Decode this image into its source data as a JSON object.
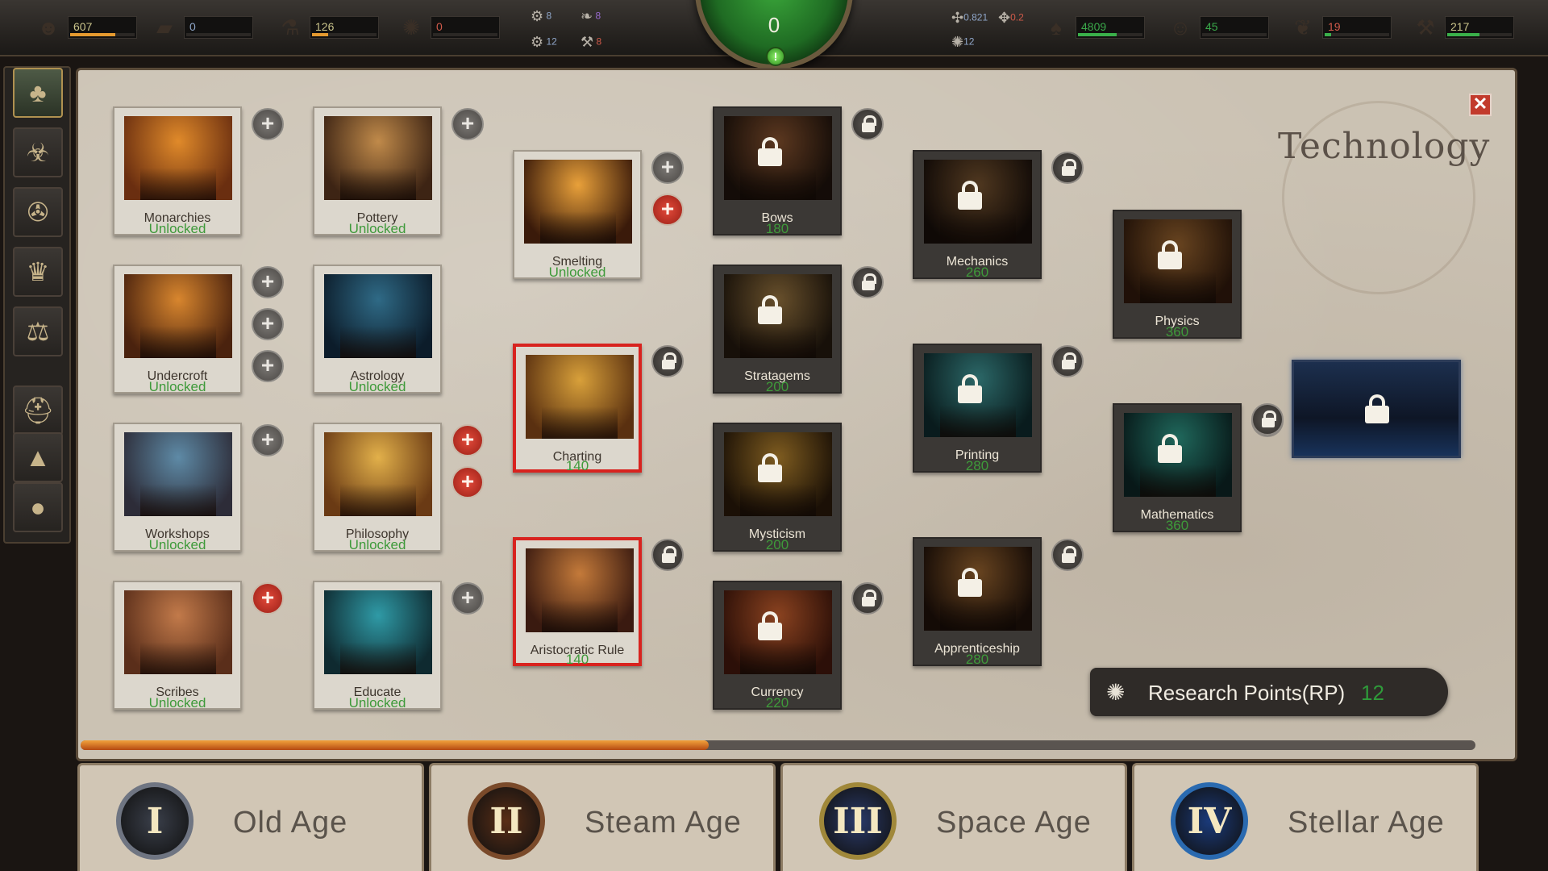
{
  "resources": {
    "left": [
      {
        "icon": "population-icon",
        "glyph": "☻",
        "value": "607",
        "value_color": "#c9c38a",
        "fill": 0.7,
        "fill_color": "#e59a2f"
      },
      {
        "icon": "sleep-bed-icon",
        "glyph": "▰",
        "value": "0",
        "value_color": "#8fa6c9",
        "fill": 0.0,
        "fill_color": "#e59a2f"
      },
      {
        "icon": "potion-icon",
        "glyph": "⚗",
        "value": "126",
        "value_color": "#c9c38a",
        "fill": 0.25,
        "fill_color": "#e59a2f"
      },
      {
        "icon": "virus-icon",
        "glyph": "✺",
        "value": "0",
        "value_color": "#d05a4a",
        "fill": 0.0,
        "fill_color": "#e59a2f"
      }
    ],
    "right": [
      {
        "icon": "mushroom-icon",
        "glyph": "♠",
        "value": "4809",
        "value_color": "#3aa84a",
        "fill": 0.6,
        "fill_color": "#3ab04a"
      },
      {
        "icon": "scholar-icon",
        "glyph": "☺",
        "value": "45",
        "value_color": "#3aa84a",
        "fill": 0.0,
        "fill_color": "#3ab04a"
      },
      {
        "icon": "grain-icon",
        "glyph": "❦",
        "value": "19",
        "value_color": "#d05a4a",
        "fill": 0.1,
        "fill_color": "#3ab04a"
      },
      {
        "icon": "tool-icon",
        "glyph": "⚒",
        "value": "217",
        "value_color": "#c9c38a",
        "fill": 0.5,
        "fill_color": "#3ab04a"
      }
    ],
    "mini_left": [
      {
        "icon": "gear-globe-icon",
        "glyph": "⚙",
        "value": "8",
        "color": "#8fa6c9"
      },
      {
        "icon": "leaf-icon",
        "glyph": "❧",
        "value": "8",
        "color": "#9a6bd0"
      },
      {
        "icon": "cog-icon",
        "glyph": "⚙",
        "value": "12",
        "color": "#8fa6c9"
      },
      {
        "icon": "hammer-icon",
        "glyph": "⚒",
        "value": "8",
        "color": "#d05a4a"
      }
    ],
    "mini_right": [
      {
        "icon": "dna-icon",
        "glyph": "✣",
        "value": "0.821",
        "color": "#8fa6c9"
      },
      {
        "icon": "rate-icon",
        "glyph": "✥",
        "value": "0.2",
        "color": "#d05a4a"
      },
      {
        "icon": "research-icon",
        "glyph": "✺",
        "value": "12",
        "color": "#8fa6c9"
      }
    ],
    "dial_value": "0",
    "dial_button": "!"
  },
  "sidebar": [
    {
      "name": "tech-tree-icon",
      "glyph": "♣",
      "active": true
    },
    {
      "name": "dna-icon",
      "glyph": "☣",
      "active": false
    },
    {
      "name": "map-compass-icon",
      "glyph": "✇",
      "active": false
    },
    {
      "name": "commander-icon",
      "glyph": "♛",
      "active": false
    },
    {
      "name": "scales-icon",
      "glyph": "⚖",
      "active": false
    },
    {
      "name": "helmet-icon",
      "glyph": "⛑",
      "active": false
    },
    {
      "name": "landscape-icon",
      "glyph": "▲",
      "active": false
    },
    {
      "name": "night-icon",
      "glyph": "●",
      "active": false
    }
  ],
  "panel": {
    "title": "Technology",
    "close_glyph": "✕"
  },
  "techs": [
    {
      "id": "monarchies",
      "name": "Monarchies",
      "status": "Unlocked",
      "locked": false,
      "selected": false,
      "art": [
        "#e08a2a",
        "#6a2e10"
      ],
      "buttons": [
        "plus"
      ]
    },
    {
      "id": "pottery",
      "name": "Pottery",
      "status": "Unlocked",
      "locked": false,
      "selected": false,
      "art": [
        "#c08a4a",
        "#3d2414"
      ],
      "buttons": [
        "plus"
      ]
    },
    {
      "id": "undercroft",
      "name": "Undercroft",
      "status": "Unlocked",
      "locked": false,
      "selected": false,
      "art": [
        "#d8862e",
        "#4a220e"
      ],
      "buttons": [
        "plus",
        "plus",
        "plus"
      ]
    },
    {
      "id": "astrology",
      "name": "Astrology",
      "status": "Unlocked",
      "locked": false,
      "selected": false,
      "art": [
        "#2f6a86",
        "#0c1c2a"
      ],
      "buttons": []
    },
    {
      "id": "workshops",
      "name": "Workshops",
      "status": "Unlocked",
      "locked": false,
      "selected": false,
      "art": [
        "#5e8aa6",
        "#2d2c38"
      ],
      "buttons": [
        "plus"
      ]
    },
    {
      "id": "philosophy",
      "name": "Philosophy",
      "status": "Unlocked",
      "locked": false,
      "selected": false,
      "art": [
        "#e2b04a",
        "#6a3a14"
      ],
      "buttons": [
        "red",
        "red"
      ]
    },
    {
      "id": "scribes",
      "name": "Scribes",
      "status": "Unlocked",
      "locked": false,
      "selected": false,
      "art": [
        "#c27a4a",
        "#5a2e1a"
      ],
      "buttons": [
        "red"
      ]
    },
    {
      "id": "educate",
      "name": "Educate",
      "status": "Unlocked",
      "locked": false,
      "selected": false,
      "art": [
        "#2f9aa6",
        "#0f2a30"
      ],
      "buttons": [
        "plus"
      ]
    },
    {
      "id": "smelting",
      "name": "Smelting",
      "status": "Unlocked",
      "locked": false,
      "selected": false,
      "art": [
        "#e8a03a",
        "#3a1a0a"
      ],
      "buttons": [
        "plus",
        "red"
      ]
    },
    {
      "id": "charting",
      "name": "Charting",
      "status": "140",
      "locked": false,
      "selected": true,
      "art": [
        "#d8a03a",
        "#5a3010"
      ],
      "buttons": [
        "lock"
      ]
    },
    {
      "id": "aristocratic-rule",
      "name": "Aristocratic Rule",
      "status": "140",
      "locked": false,
      "selected": true,
      "art": [
        "#c47a3a",
        "#3a1a10"
      ],
      "buttons": [
        "lock"
      ]
    },
    {
      "id": "bows",
      "name": "Bows",
      "status": "180",
      "locked": true,
      "selected": false,
      "art": [
        "#7a4a2a",
        "#1a100a"
      ],
      "buttons": [
        "lock"
      ]
    },
    {
      "id": "stratagems",
      "name": "Stratagems",
      "status": "200",
      "locked": true,
      "selected": false,
      "art": [
        "#8a6a3a",
        "#1e150c"
      ],
      "buttons": [
        "lock"
      ]
    },
    {
      "id": "mysticism",
      "name": "Mysticism",
      "status": "200",
      "locked": true,
      "selected": false,
      "art": [
        "#a87a2a",
        "#241608"
      ],
      "buttons": []
    },
    {
      "id": "currency",
      "name": "Currency",
      "status": "220",
      "locked": true,
      "selected": false,
      "art": [
        "#b8582a",
        "#3a140a"
      ],
      "buttons": [
        "lock"
      ]
    },
    {
      "id": "mechanics",
      "name": "Mechanics",
      "status": "260",
      "locked": true,
      "selected": false,
      "art": [
        "#6a4a2a",
        "#140c08"
      ],
      "buttons": [
        "lock"
      ]
    },
    {
      "id": "printing",
      "name": "Printing",
      "status": "280",
      "locked": true,
      "selected": false,
      "art": [
        "#3a8a8a",
        "#0c2426"
      ],
      "buttons": [
        "lock"
      ]
    },
    {
      "id": "apprenticeship",
      "name": "Apprenticeship",
      "status": "280",
      "locked": true,
      "selected": false,
      "art": [
        "#8a5a2a",
        "#1a0e08"
      ],
      "buttons": [
        "lock"
      ]
    },
    {
      "id": "physics",
      "name": "Physics",
      "status": "360",
      "locked": true,
      "selected": false,
      "art": [
        "#8a5a2a",
        "#2a160a"
      ],
      "buttons": []
    },
    {
      "id": "mathematics",
      "name": "Mathematics",
      "status": "360",
      "locked": true,
      "selected": false,
      "art": [
        "#2a8a7a",
        "#0a2020"
      ],
      "buttons": [
        "lock"
      ]
    }
  ],
  "research_points": {
    "label": "Research Points(RP)",
    "value": "12",
    "icon_glyph": "✺"
  },
  "progress": 0.45,
  "ages": [
    {
      "numeral": "I",
      "name": "Old Age",
      "ring": "#6f7582",
      "fill": "#3a3f4a",
      "active": true
    },
    {
      "numeral": "II",
      "name": "Steam Age",
      "ring": "#7a4a2a",
      "fill": "#5a2e16",
      "active": false
    },
    {
      "numeral": "III",
      "name": "Space Age",
      "ring": "#a0883a",
      "fill": "#2a3a6a",
      "active": false
    },
    {
      "numeral": "IV",
      "name": "Stellar Age",
      "ring": "#2a6ab0",
      "fill": "#1a3a7a",
      "active": false
    }
  ]
}
